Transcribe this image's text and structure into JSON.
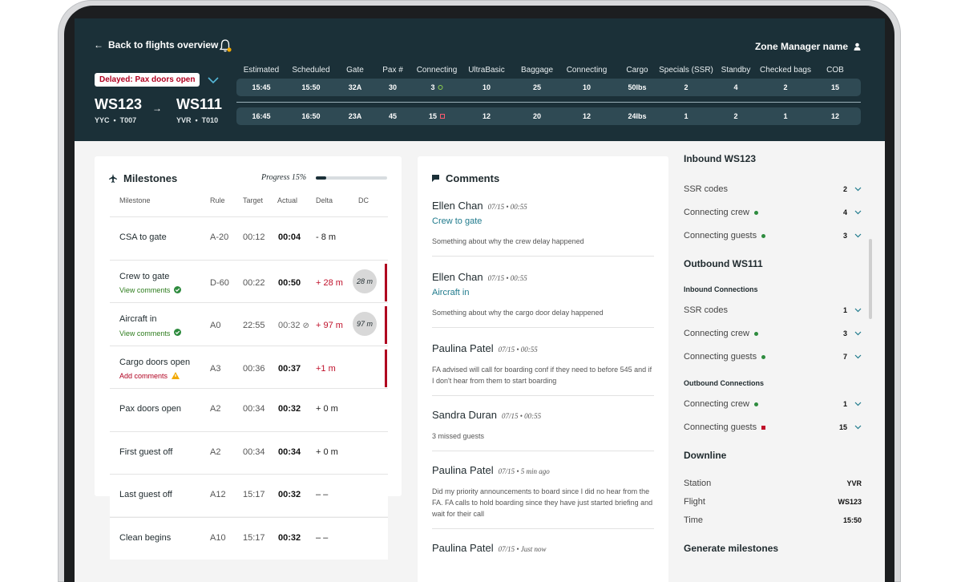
{
  "header": {
    "back_label": "Back to flights overview",
    "user": "Zone Manager name",
    "status_badge": "Delayed: Pax doors open",
    "inbound": {
      "flight": "WS123",
      "station": "YYC",
      "tail": "T007"
    },
    "outbound": {
      "flight": "WS111",
      "station": "YVR",
      "tail": "T010"
    },
    "columns": [
      "Estimated",
      "Scheduled",
      "Gate",
      "Pax #",
      "Connecting",
      "UltraBasic",
      "Baggage",
      "Connecting",
      "Cargo",
      "Specials (SSR)",
      "Standby",
      "Checked bags",
      "COB"
    ],
    "row_inbound": [
      "15:45",
      "15:50",
      "32A",
      "30",
      "3",
      "10",
      "25",
      "10",
      "50lbs",
      "2",
      "4",
      "2",
      "15"
    ],
    "row_outbound": [
      "16:45",
      "16:50",
      "23A",
      "45",
      "15",
      "12",
      "20",
      "12",
      "24lbs",
      "1",
      "2",
      "1",
      "12"
    ]
  },
  "milestones": {
    "title": "Milestones",
    "progress_label": "Progress 15%",
    "progress": 0.15,
    "headers": [
      "Milestone",
      "Rule",
      "Target",
      "Actual",
      "Delta",
      "DC"
    ],
    "rows": [
      {
        "name": "CSA to gate",
        "link": "",
        "rule": "A-20",
        "target": "00:12",
        "actual": "00:04",
        "delta": "- 8 m",
        "dc": ""
      },
      {
        "name": "Crew to gate",
        "link": "View comments",
        "rule": "D-60",
        "target": "00:22",
        "actual": "00:50",
        "delta": "+ 28 m",
        "dc": "28 m"
      },
      {
        "name": "Aircraft in",
        "link": "View comments",
        "rule": "A0",
        "target": "22:55",
        "actual": "00:32",
        "delta": "+ 97 m",
        "dc": "97 m"
      },
      {
        "name": "Cargo doors open",
        "link": "Add comments",
        "rule": "A3",
        "target": "00:36",
        "actual": "00:37",
        "delta": "+1 m",
        "dc": ""
      },
      {
        "name": "Pax doors open",
        "link": "",
        "rule": "A2",
        "target": "00:34",
        "actual": "00:32",
        "delta": "+ 0 m",
        "dc": ""
      },
      {
        "name": "First guest off",
        "link": "",
        "rule": "A2",
        "target": "00:34",
        "actual": "00:34",
        "delta": "+ 0 m",
        "dc": ""
      },
      {
        "name": "Last guest off",
        "link": "",
        "rule": "A12",
        "target": "15:17",
        "actual": "00:32",
        "delta": "– –",
        "dc": ""
      },
      {
        "name": "Clean begins",
        "link": "",
        "rule": "A10",
        "target": "15:17",
        "actual": "00:32",
        "delta": "– –",
        "dc": ""
      }
    ]
  },
  "comments": {
    "title": "Comments",
    "items": [
      {
        "author": "Ellen Chan",
        "date": "07/15",
        "time": "00:55",
        "tag": "Crew to gate",
        "text": "Something about why the crew delay happened"
      },
      {
        "author": "Ellen Chan",
        "date": "07/15",
        "time": "00:55",
        "tag": "Aircraft in",
        "text": "Something about why the cargo door delay happened"
      },
      {
        "author": "Paulina Patel",
        "date": "07/15",
        "time": "00:55",
        "tag": "",
        "text": "FA advised will call for boarding conf if they need to before 545 and if I don't hear from them to start boarding"
      },
      {
        "author": "Sandra Duran",
        "date": "07/15",
        "time": "00:55",
        "tag": "",
        "text": "3 missed guests"
      },
      {
        "author": "Paulina Patel",
        "date": "07/15",
        "time": "5 min ago",
        "tag": "",
        "text": "Did my priority announcements to board since I did no hear from the FA. FA calls to hold boarding since they have just started briefing and wait for their call"
      },
      {
        "author": "Paulina Patel",
        "date": "07/15",
        "time": "Just now",
        "tag": "",
        "text": ""
      }
    ]
  },
  "sidebar": {
    "inbound_title": "Inbound WS123",
    "inbound_rows": [
      {
        "label": "SSR codes",
        "value": "2",
        "status": ""
      },
      {
        "label": "Connecting crew",
        "value": "4",
        "status": "ok"
      },
      {
        "label": "Connecting guests",
        "value": "3",
        "status": "ok"
      }
    ],
    "outbound_title": "Outbound WS111",
    "inbound_conn_title": "Inbound Connections",
    "inbound_conn_rows": [
      {
        "label": "SSR codes",
        "value": "1",
        "status": ""
      },
      {
        "label": "Connecting crew",
        "value": "3",
        "status": "ok"
      },
      {
        "label": "Connecting guests",
        "value": "7",
        "status": "ok"
      }
    ],
    "outbound_conn_title": "Outbound Connections",
    "outbound_conn_rows": [
      {
        "label": "Connecting crew",
        "value": "1",
        "status": "ok"
      },
      {
        "label": "Connecting guests",
        "value": "15",
        "status": "alert"
      }
    ],
    "downline_title": "Downline",
    "downline": [
      {
        "label": "Station",
        "value": "YVR"
      },
      {
        "label": "Flight",
        "value": "WS123"
      },
      {
        "label": "Time",
        "value": "15:50"
      }
    ],
    "generate_title": "Generate milestones"
  },
  "colors": {
    "header_bg": "#1b3038",
    "accent": "#1f7a8c",
    "alert": "#b00020",
    "ok": "#2e8b3e"
  }
}
